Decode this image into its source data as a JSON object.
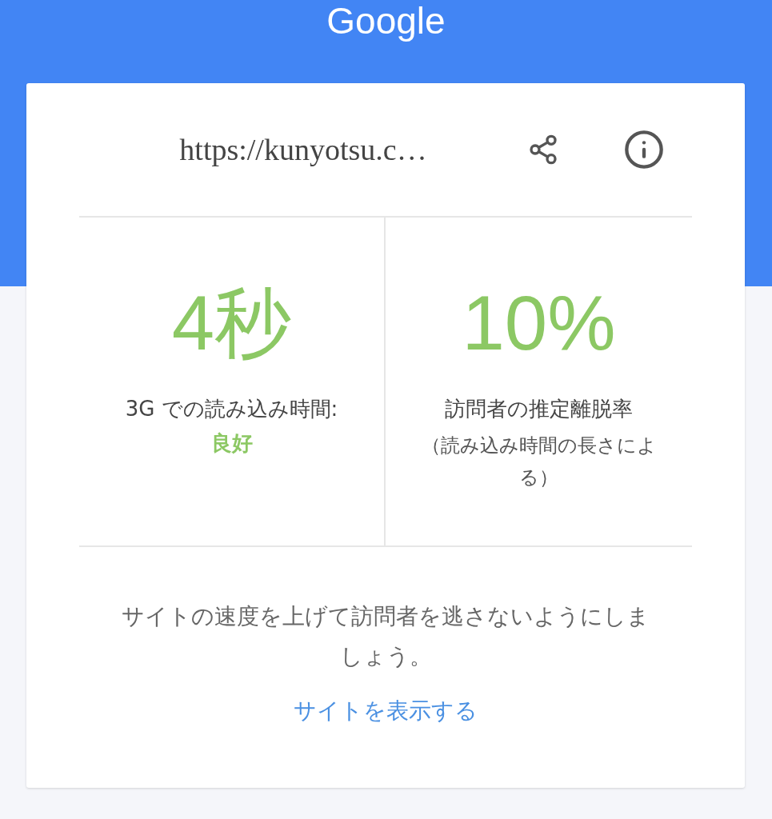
{
  "header": {
    "logo": "Google"
  },
  "card": {
    "url": "https://kunyotsu.c…",
    "metrics": [
      {
        "kind": "time",
        "value": "4秒",
        "label": "3G での読み込み時間:",
        "rating": "良好"
      },
      {
        "kind": "rate",
        "value": "10%",
        "label": "訪問者の推定離脱率",
        "note": "（読み込み時間の長さによる）"
      }
    ],
    "message": "サイトの速度を上げて訪問者を逃さないようにしましょう。",
    "link": "サイトを表示する"
  }
}
